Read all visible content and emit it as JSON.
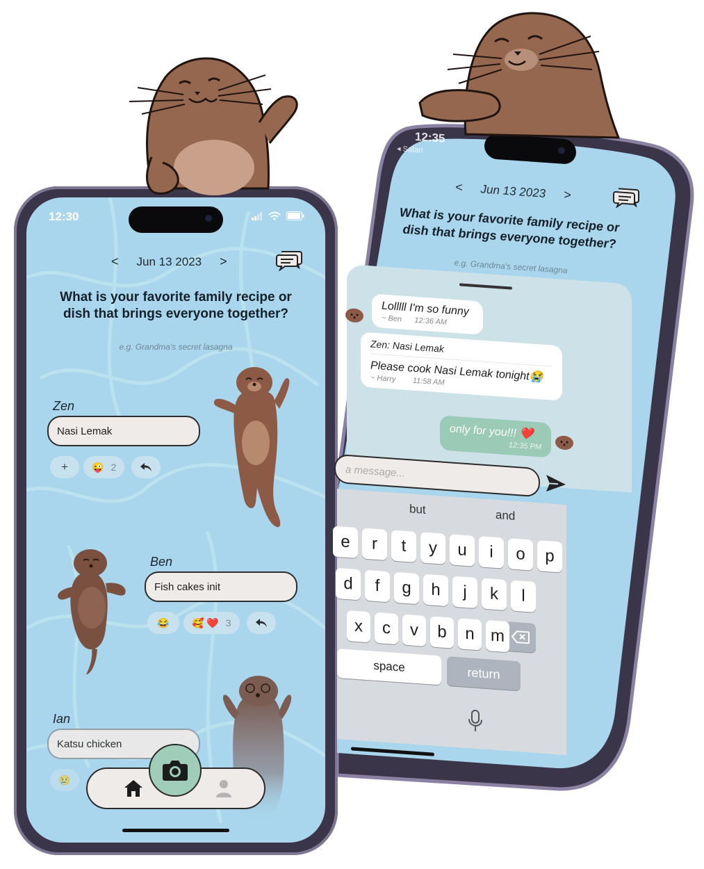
{
  "left_phone": {
    "status_time": "12:30",
    "date_nav": {
      "prev": "<",
      "date": "Jun 13 2023",
      "next": ">"
    },
    "question": "What is your favorite family recipe or dish that brings everyone together?",
    "hint": "e.g. Grandma's secret lasagna",
    "answers": [
      {
        "author": "Zen",
        "text": "Nasi Lemak",
        "reactions": [
          {
            "label": "+"
          },
          {
            "label": "😜",
            "count": "2"
          }
        ]
      },
      {
        "author": "Ben",
        "text": "Fish cakes init",
        "reactions": [
          {
            "label": "😂"
          },
          {
            "label": "🥰 ❤️",
            "count": "3"
          }
        ]
      },
      {
        "author": "Ian",
        "text": "Katsu chicken",
        "reactions": [
          {
            "label": "😢"
          }
        ]
      }
    ],
    "icons": {
      "reply": "reply-arrow-icon",
      "home": "home-icon",
      "profile": "profile-icon",
      "camera": "camera-icon",
      "chat": "chat-bubbles-icon"
    }
  },
  "right_phone": {
    "status_time": "12:35",
    "back_label": "◂ Safari",
    "date_nav": {
      "prev": "<",
      "date": "Jun 13 2023",
      "next": ">"
    },
    "question": "What is your favorite family recipe or dish that brings everyone together?",
    "hint": "e.g. Grandma's secret lasagna",
    "messages": [
      {
        "text": "Lolllll I'm so funny",
        "sender": "~ Ben",
        "time": "12:36 AM"
      },
      {
        "quote": "Zen: Nasi Lemak",
        "text": "Please cook Nasi Lemak tonight😭",
        "sender": "~ Harry",
        "time": "11:58 AM"
      },
      {
        "text": "only for you!!! ❤️",
        "time": "12:35 PM"
      }
    ],
    "input_placeholder": "a message...",
    "keyboard": {
      "suggestions": [
        "but",
        "and"
      ],
      "row1": [
        "e",
        "r",
        "t",
        "y",
        "u",
        "i",
        "o",
        "p"
      ],
      "row2": [
        "d",
        "f",
        "g",
        "h",
        "j",
        "k",
        "l"
      ],
      "row3": [
        "x",
        "c",
        "v",
        "b",
        "n",
        "m"
      ],
      "space": "space",
      "return": "return"
    }
  }
}
